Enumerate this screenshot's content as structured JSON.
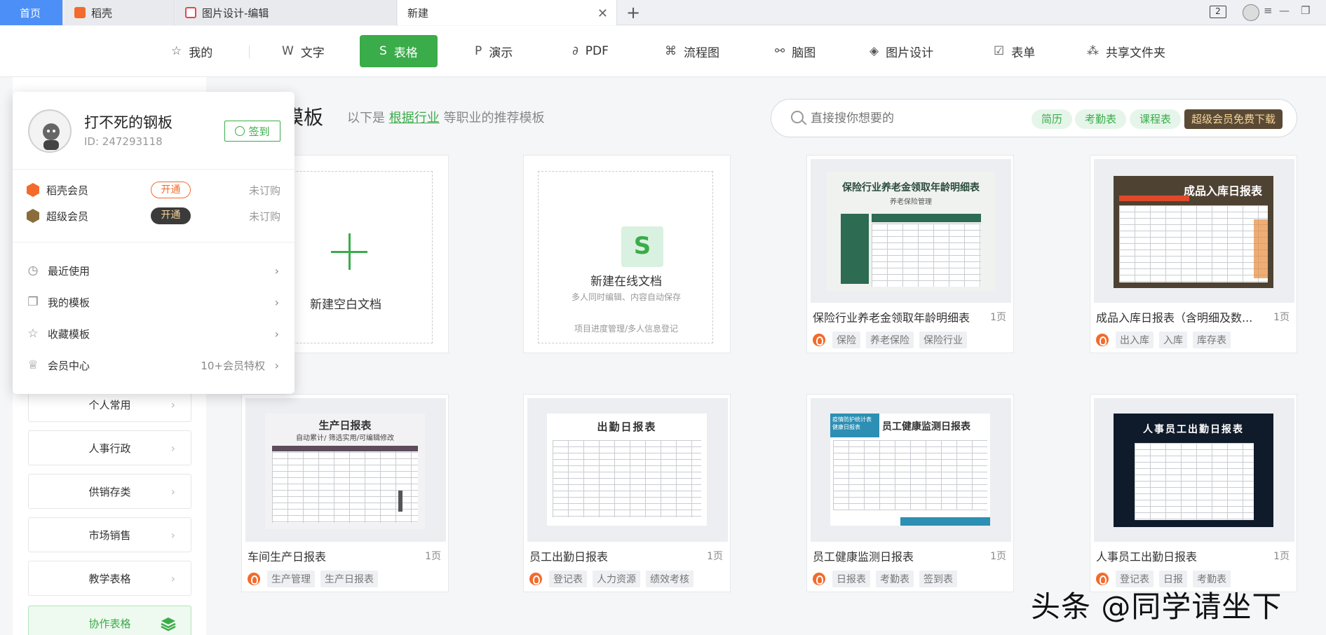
{
  "tabs": {
    "home": "首页",
    "items": [
      {
        "label": "稻壳"
      },
      {
        "label": "图片设计-编辑"
      },
      {
        "label": "新建"
      }
    ],
    "window_count": "2"
  },
  "categories": [
    {
      "label": "我的",
      "icon": "star-icon"
    },
    {
      "label": "文字",
      "icon": "w-icon"
    },
    {
      "label": "表格",
      "icon": "s-icon",
      "active": true
    },
    {
      "label": "演示",
      "icon": "p-icon"
    },
    {
      "label": "PDF",
      "icon": "pdf-icon"
    },
    {
      "label": "流程图",
      "icon": "flow-icon"
    },
    {
      "label": "脑图",
      "icon": "mindmap-icon"
    },
    {
      "label": "图片设计",
      "icon": "image-design-icon"
    },
    {
      "label": "表单",
      "icon": "form-icon"
    },
    {
      "label": "共享文件夹",
      "icon": "share-folder-icon"
    }
  ],
  "sidebar": {
    "items": [
      {
        "label": "个人常用"
      },
      {
        "label": "人事行政"
      },
      {
        "label": "供销存类"
      },
      {
        "label": "市场销售"
      },
      {
        "label": "教学表格"
      },
      {
        "label": "协作表格"
      }
    ]
  },
  "main": {
    "title_partial": "模板",
    "subtitle_prefix": "以下是",
    "subtitle_link": "根据行业",
    "subtitle_suffix": "等职业的推荐模板",
    "search_placeholder": "直接搜你想要的",
    "chips": [
      "简历",
      "考勤表",
      "课程表"
    ],
    "vip_chip": "超级会员免费下载"
  },
  "cards": {
    "blank": {
      "label": "新建空白文档"
    },
    "online": {
      "label": "新建在线文档",
      "sub": "多人同时编辑、内容自动保存",
      "hint": "项目进度管理/多人信息登记"
    },
    "templates": [
      {
        "title": "保险行业养老金领取年龄明细表",
        "pages": "1页",
        "tags": [
          "保险",
          "养老保险",
          "保险行业"
        ],
        "thumb_title": "保险行业养老金领取年龄明细表",
        "thumb_sub": "养老保险管理"
      },
      {
        "title": "成品入库日报表（含明细及数...",
        "pages": "1页",
        "tags": [
          "出入库",
          "入库",
          "库存表"
        ],
        "thumb_title": "成品入库日报表"
      },
      {
        "title": "车间生产日报表",
        "pages": "1页",
        "tags": [
          "生产管理",
          "生产日报表"
        ],
        "thumb_title": "生产日报表",
        "thumb_sub": "自动累计/ 筛选实用/可编辑修改"
      },
      {
        "title": "员工出勤日报表",
        "pages": "1页",
        "tags": [
          "登记表",
          "人力资源",
          "绩效考核"
        ],
        "thumb_title": "出勤日报表"
      },
      {
        "title": "员工健康监测日报表",
        "pages": "1页",
        "tags": [
          "日报表",
          "考勤表",
          "签到表"
        ],
        "thumb_title": "员工健康监测日报表",
        "thumb_badge": "疫情防护统计表 健康日报表"
      },
      {
        "title": "人事员工出勤日报表",
        "pages": "1页",
        "tags": [
          "登记表",
          "日报",
          "考勤表"
        ],
        "thumb_title": "人事员工出勤日报表"
      }
    ]
  },
  "popup": {
    "name": "打不死的钢板",
    "id": "ID: 247293118",
    "checkin": "签到",
    "members": [
      {
        "label": "稻壳会员",
        "button": "开通",
        "status": "未订购",
        "color": "#f26b2c"
      },
      {
        "label": "超级会员",
        "button": "开通",
        "status": "未订购",
        "color": "#8a6d3b"
      }
    ],
    "menu": [
      {
        "label": "最近使用",
        "icon": "clock-icon"
      },
      {
        "label": "我的模板",
        "icon": "template-icon"
      },
      {
        "label": "收藏模板",
        "icon": "star-outline-icon"
      },
      {
        "label": "会员中心",
        "icon": "crown-icon",
        "extra": "10+会员特权"
      }
    ]
  },
  "watermark": "头条 @同学请坐下",
  "colors": {
    "accent": "#3aac4a",
    "tab_active": "#4c8ff7",
    "docer": "#f26b2c"
  }
}
